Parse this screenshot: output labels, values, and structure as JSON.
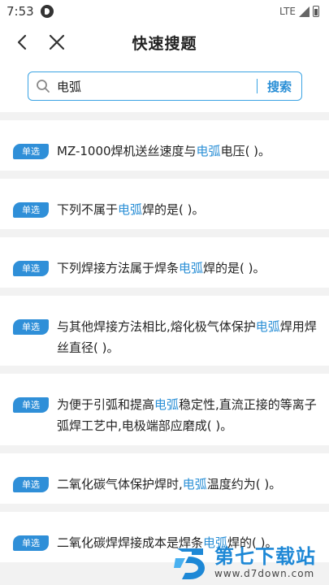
{
  "status_bar": {
    "time": "7:53",
    "network": "LTE",
    "app_icon": "app-notification-icon"
  },
  "nav": {
    "title": "快速搜题",
    "back_icon": "chevron-left-icon",
    "close_icon": "close-icon"
  },
  "search": {
    "value": "电弧",
    "button_label": "搜索"
  },
  "colors": {
    "accent": "#2a8fd6",
    "badge": "#2f8fd8",
    "search_border": "#3aa3e3",
    "background": "#f2f2f2"
  },
  "results": [
    {
      "badge": "单选",
      "parts": [
        {
          "text": "MZ-1000焊机送丝速度与"
        },
        {
          "text": "电弧",
          "hl": true
        },
        {
          "text": "电压( )。"
        }
      ]
    },
    {
      "badge": "单选",
      "parts": [
        {
          "text": "下列不属于"
        },
        {
          "text": "电弧",
          "hl": true
        },
        {
          "text": "焊的是( )。"
        }
      ]
    },
    {
      "badge": "单选",
      "parts": [
        {
          "text": "下列焊接方法属于焊条"
        },
        {
          "text": "电弧",
          "hl": true
        },
        {
          "text": "焊的是( )。"
        }
      ]
    },
    {
      "badge": "单选",
      "parts": [
        {
          "text": "与其他焊接方法相比,熔化极气体保护"
        },
        {
          "text": "电弧",
          "hl": true
        },
        {
          "text": "焊用焊丝直径( )。"
        }
      ]
    },
    {
      "badge": "单选",
      "parts": [
        {
          "text": "为便于引弧和提高"
        },
        {
          "text": "电弧",
          "hl": true
        },
        {
          "text": "稳定性,直流正接的等离子弧焊工艺中,电极端部应磨成( )。"
        }
      ]
    },
    {
      "badge": "单选",
      "parts": [
        {
          "text": "二氧化碳气体保护焊时,"
        },
        {
          "text": "电弧",
          "hl": true
        },
        {
          "text": "温度约为( )。"
        }
      ]
    },
    {
      "badge": "单选",
      "parts": [
        {
          "text": "二氧化碳焊焊接成本是焊条"
        },
        {
          "text": "电弧",
          "hl": true
        },
        {
          "text": "焊的( )。"
        }
      ]
    }
  ],
  "watermark": {
    "title": "第七下载站",
    "url": "www.d7down.com"
  }
}
